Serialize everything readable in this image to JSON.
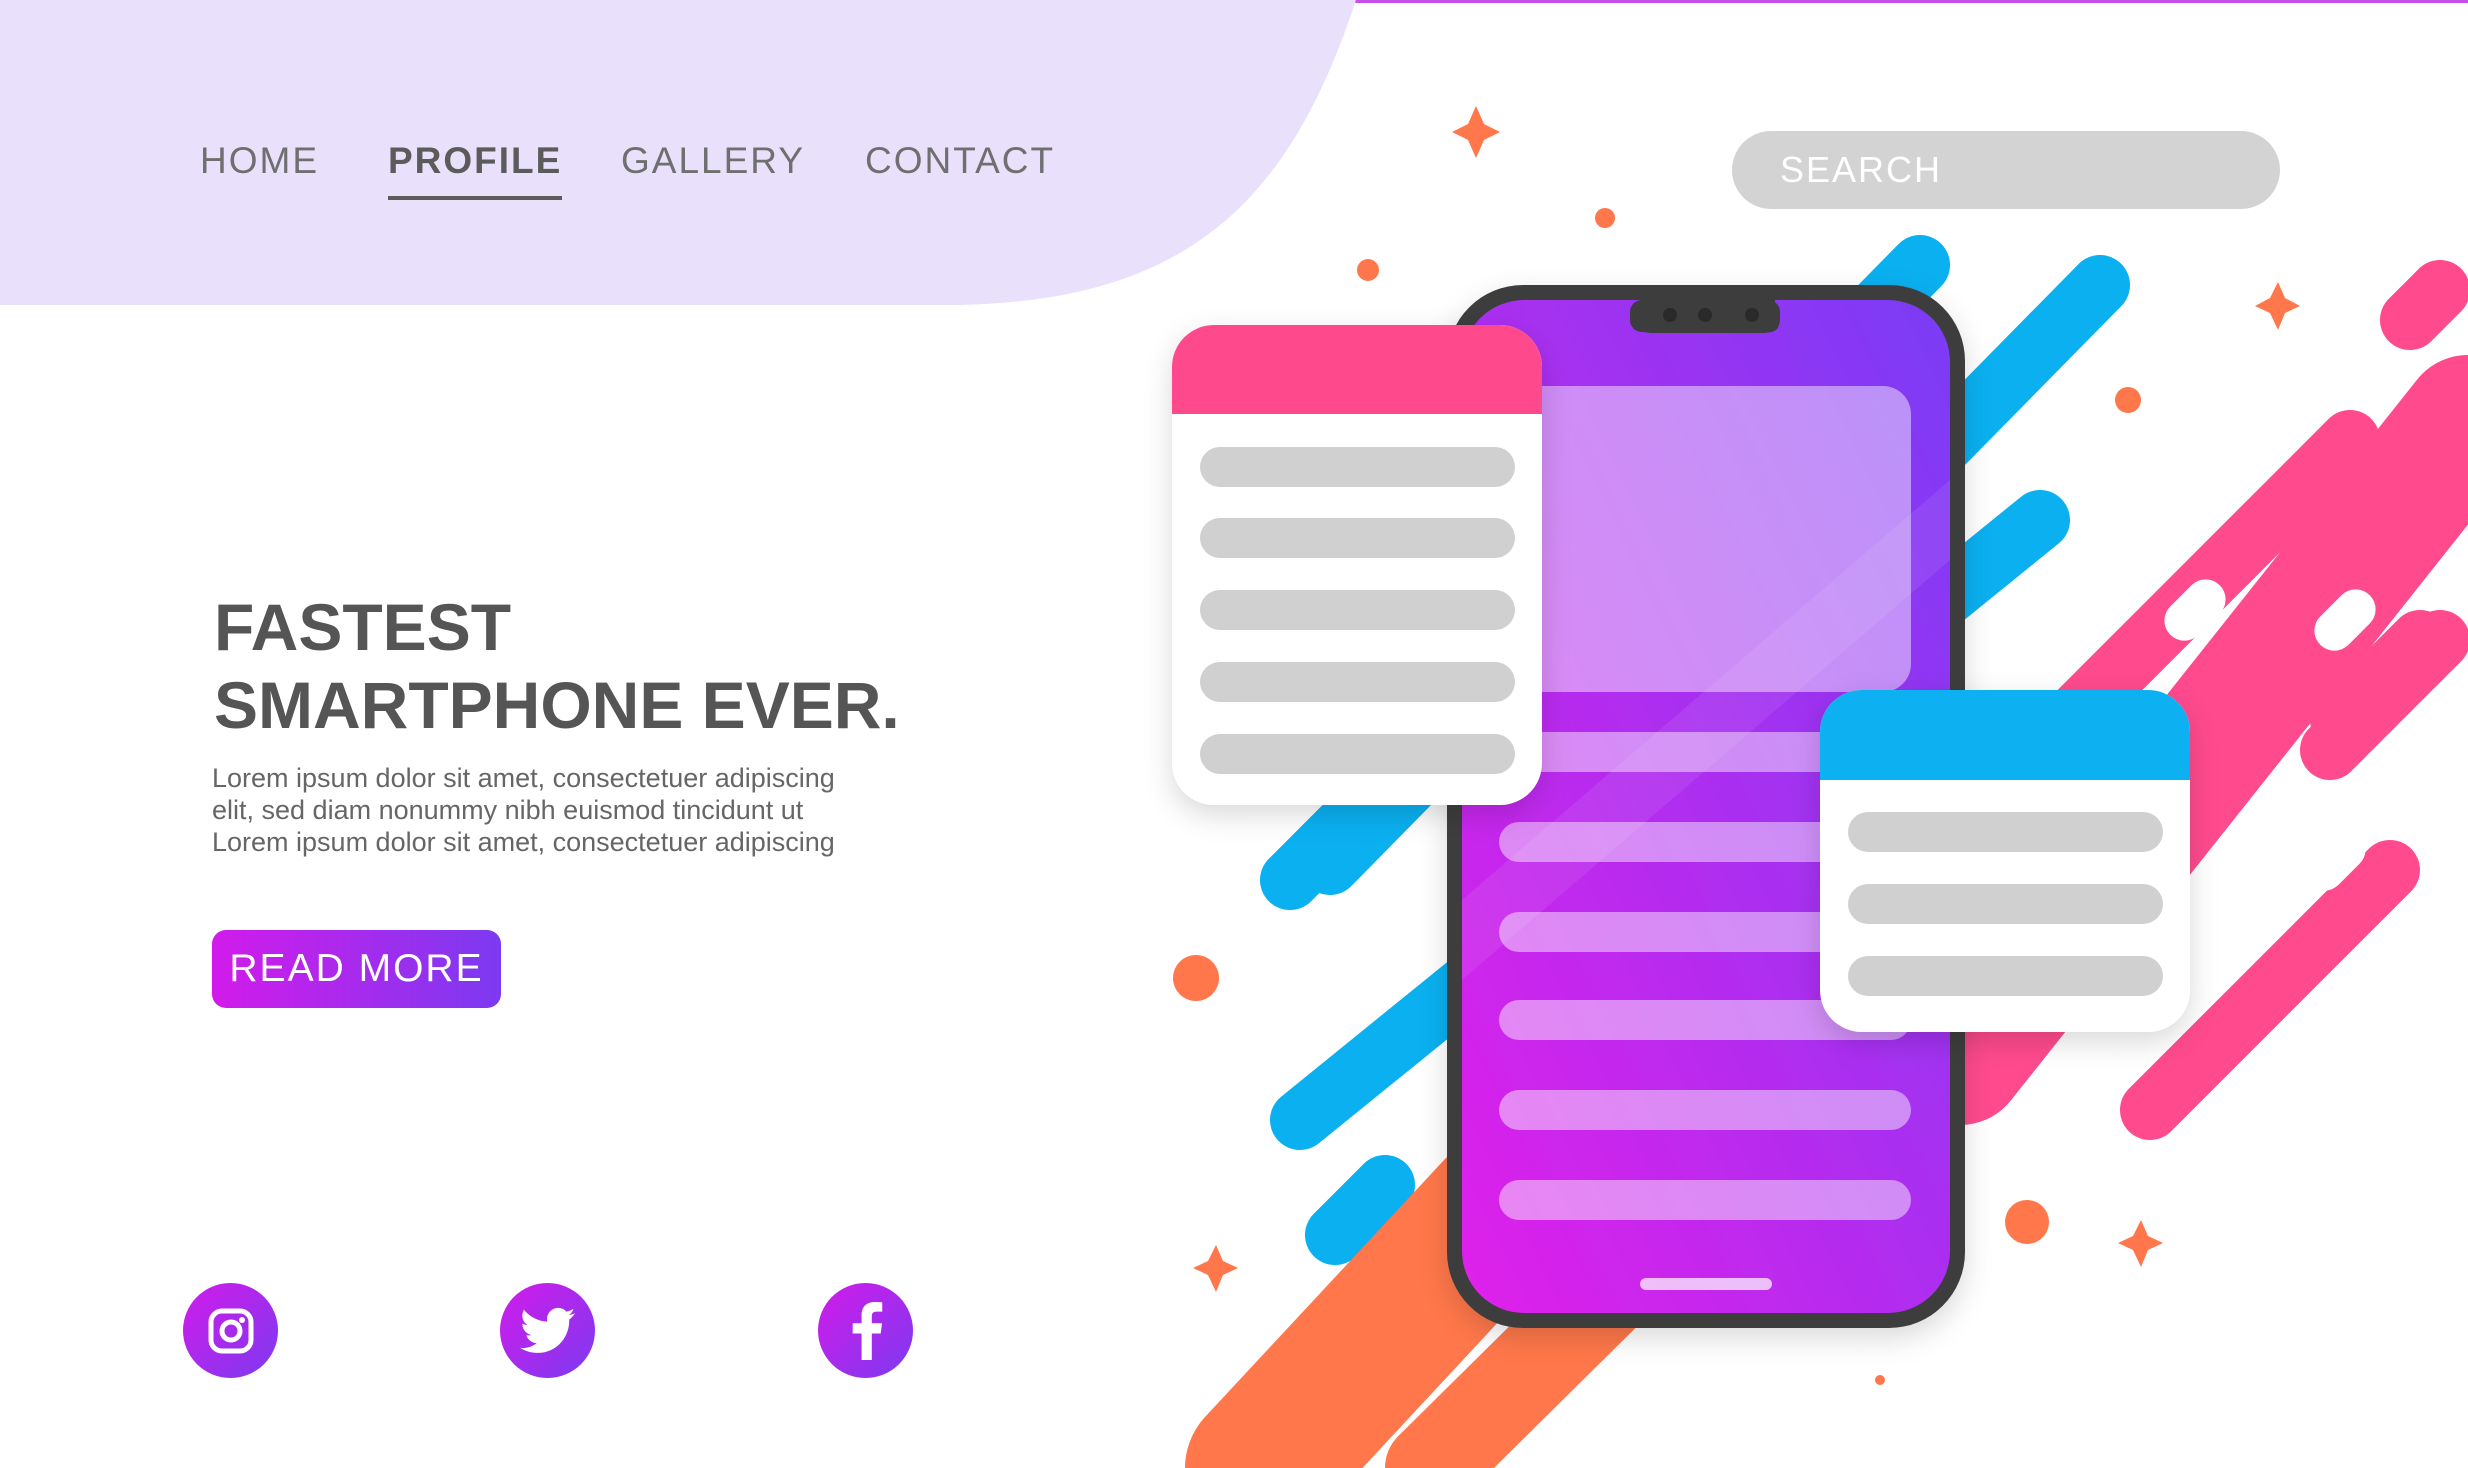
{
  "nav": {
    "items": [
      {
        "label": "HOME"
      },
      {
        "label": "PROFILE",
        "active": true
      },
      {
        "label": "GALLERY"
      },
      {
        "label": "CONTACT"
      }
    ]
  },
  "search": {
    "placeholder": "SEARCH"
  },
  "hero": {
    "title_line1": "FASTEST",
    "title_line2": "SMARTPHONE EVER.",
    "body_line1": "Lorem ipsum dolor sit amet, consectetuer adipiscing",
    "body_line2": "elit, sed diam nonummy nibh euismod tincidunt ut",
    "body_line3": "Lorem ipsum dolor sit amet, consectetuer adipiscing",
    "cta_label": "READ MORE"
  },
  "social": [
    {
      "icon": "instagram-icon"
    },
    {
      "icon": "twitter-icon"
    },
    {
      "icon": "facebook-icon"
    }
  ],
  "colors": {
    "header_bg": "#e9e1fb",
    "accent_magenta": "#d21bea",
    "accent_purple": "#7c3af0",
    "pink": "#ff4a8d",
    "blue": "#0ab0f0",
    "orange": "#ff774a",
    "gray_text": "#555555",
    "gray_bar": "#d0d0d0"
  }
}
